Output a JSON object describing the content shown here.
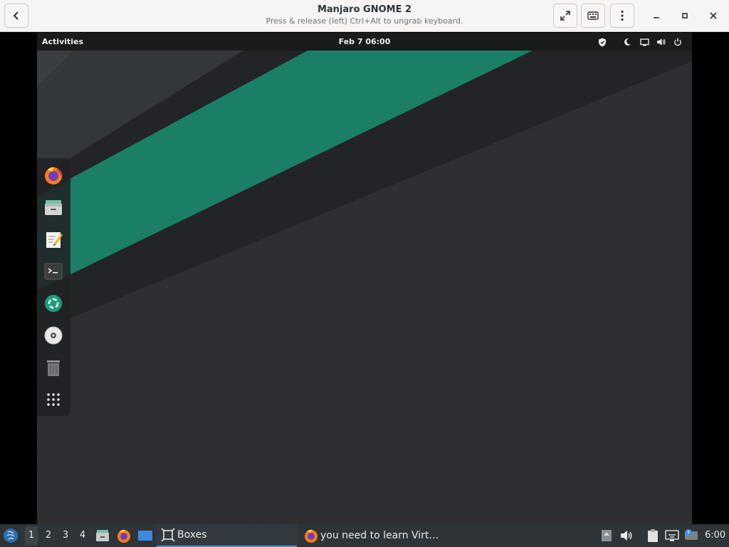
{
  "window": {
    "title": "Manjaro GNOME 2",
    "subtitle": "Press & release (left) Ctrl+Alt to ungrab keyboard."
  },
  "toolbar_icons": [
    "back-icon",
    "fullscreen-icon",
    "keyboard-icon",
    "menu-icon",
    "minimize-icon",
    "maximize-icon",
    "close-icon"
  ],
  "guest": {
    "activities_label": "Activities",
    "clock": "Feb 7  06:00",
    "tray_icons": [
      "shield-icon",
      "night-light-icon",
      "screen-icon",
      "volume-icon",
      "power-icon"
    ],
    "wallpaper_colors": {
      "accent": "#1a7f64",
      "dark": "#24272a",
      "base": "#2b2d31"
    },
    "dock_items": [
      "firefox-icon",
      "files-icon",
      "text-editor-icon",
      "terminal-icon",
      "software-icon",
      "disc-icon",
      "trash-icon",
      "app-grid-icon"
    ]
  },
  "taskbar": {
    "workspaces": [
      "1",
      "2",
      "3",
      "4"
    ],
    "tasks": [
      {
        "label": "Boxes",
        "icon": "boxes-icon"
      },
      {
        "label": "you need to learn Virt…",
        "icon": "firefox-icon"
      }
    ],
    "time": "6:00"
  }
}
